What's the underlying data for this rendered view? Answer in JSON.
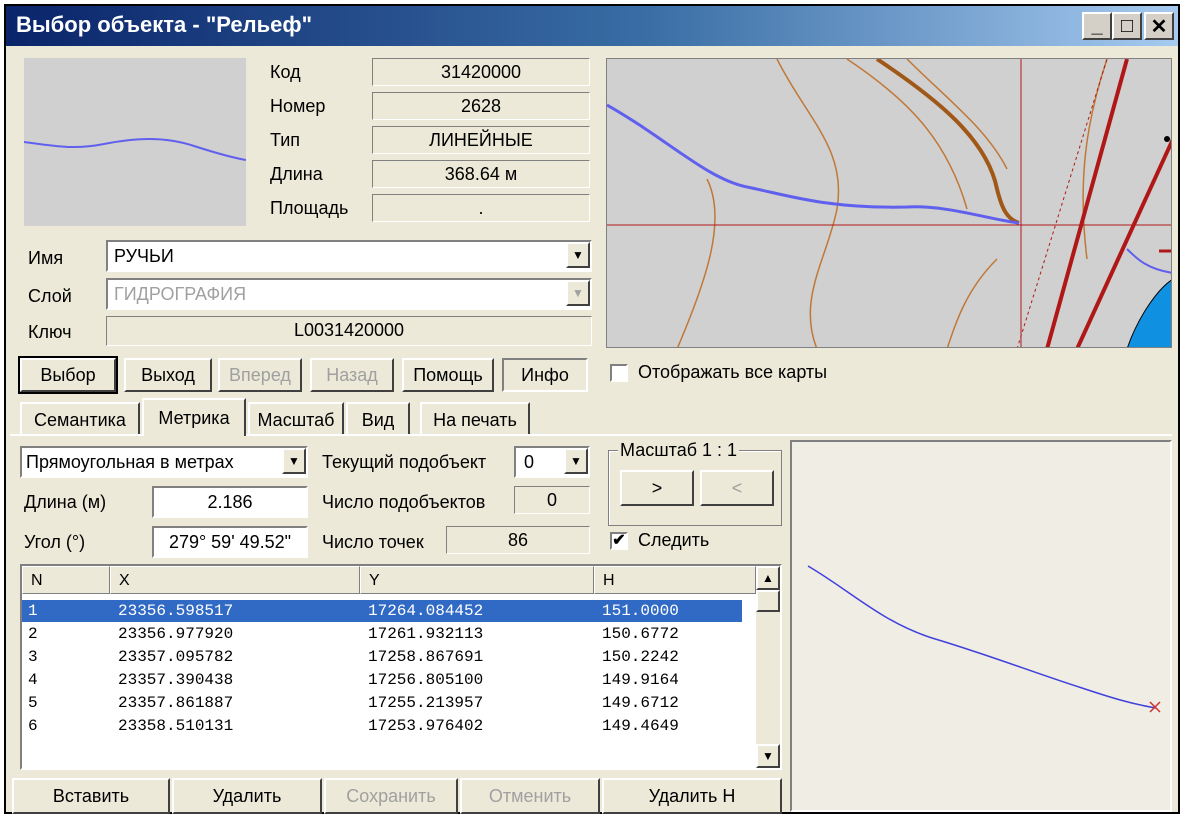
{
  "window": {
    "title": "Выбор объекта - \"Рельеф\"",
    "minimize": "_",
    "maximize": "□",
    "close": "✕"
  },
  "info": {
    "code_label": "Код",
    "code_value": "31420000",
    "number_label": "Номер",
    "number_value": "2628",
    "type_label": "Тип",
    "type_value": "ЛИНЕЙНЫЕ",
    "length_label": "Длина",
    "length_value": "368.64  м",
    "area_label": "Площадь",
    "area_value": "."
  },
  "name": {
    "label": "Имя",
    "value": "РУЧЬИ"
  },
  "layer": {
    "label": "Слой",
    "value": "ГИДРОГРАФИЯ"
  },
  "key": {
    "label": "Ключ",
    "value": "L0031420000"
  },
  "buttons": {
    "select": "Выбор",
    "exit": "Выход",
    "forward": "Вперед",
    "back": "Назад",
    "help": "Помощь",
    "info": "Инфо"
  },
  "show_all_maps": {
    "label": "Отображать все карты",
    "checked": false
  },
  "tabs": [
    "Семантика",
    "Метрика",
    "Масштаб",
    "Вид",
    "На печать"
  ],
  "metric": {
    "coord_system": "Прямоугольная в метрах",
    "current_subobject_label": "Текущий подобъект",
    "current_subobject_value": "0",
    "subobject_count_label": "Число подобъектов",
    "subobject_count_value": "0",
    "point_count_label": "Число точек",
    "point_count_value": "86",
    "length_label": "Длина (м)",
    "length_value": "2.186",
    "angle_label": "Угол (°)",
    "angle_value": "279° 59' 49.52\"",
    "scale_label": "Масштаб 1 : 1",
    "scale_next": ">",
    "scale_prev": "<",
    "follow_label": "Следить",
    "follow_checked": true
  },
  "table": {
    "columns": [
      "N",
      "X",
      "Y",
      "H"
    ],
    "rows": [
      [
        "1",
        "23356.598517",
        "17264.084452",
        "151.0000"
      ],
      [
        "2",
        "23356.977920",
        "17261.932113",
        "150.6772"
      ],
      [
        "3",
        "23357.095782",
        "17258.867691",
        "150.2242"
      ],
      [
        "4",
        "23357.390438",
        "17256.805100",
        "149.9164"
      ],
      [
        "5",
        "23357.861887",
        "17255.213957",
        "149.6712"
      ],
      [
        "6",
        "23358.510131",
        "17253.976402",
        "149.4649"
      ]
    ],
    "selected_row": 0
  },
  "bottom_buttons": {
    "insert": "Вставить",
    "delete": "Удалить",
    "save": "Сохранить",
    "cancel": "Отменить",
    "delete_h": "Удалить Н"
  },
  "colors": {
    "titlebar": "#0a246a",
    "selection": "#316ac5",
    "stream": "#6060ee",
    "contour": "#c07838",
    "road": "#b01818",
    "water": "#1090e0",
    "map_bg": "#d0d0d0"
  },
  "icons": {
    "combo": "chevron-down-icon",
    "scroll_up": "arrow-up-icon",
    "scroll_down": "arrow-down-icon",
    "checkbox": "checkmark-icon"
  }
}
